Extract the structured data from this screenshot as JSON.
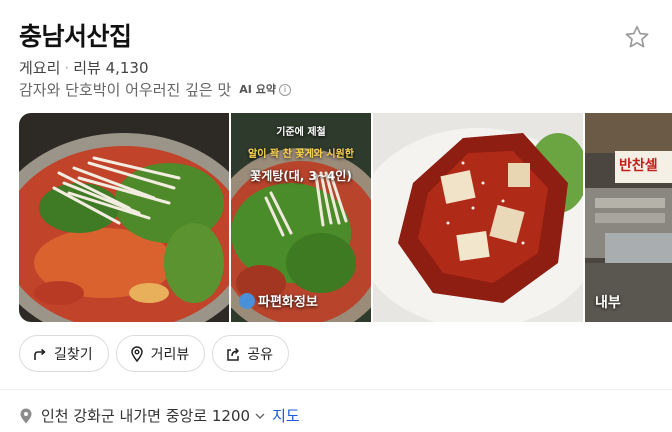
{
  "place": {
    "name": "충남서산집",
    "category": "게요리",
    "review_label": "리뷰",
    "review_count": "4,130",
    "description": "감자와 단호박이 어우러진 깊은 맛",
    "ai_badge": "AI 요약"
  },
  "photos": [
    {
      "label": ""
    },
    {
      "overlay_line1": "기준에 제철",
      "overlay_line2": "알이 꽉 찬 꽃게와 시원한",
      "overlay_line3": "꽃게탕(대, 3~4인)",
      "source": "파편화정보"
    },
    {
      "label": ""
    },
    {
      "label": "내부",
      "sign": "반찬셀"
    }
  ],
  "actions": {
    "directions": "길찾기",
    "street_view": "거리뷰",
    "share": "공유"
  },
  "address": {
    "text": "인천 강화군 내가면 중앙로 1200",
    "map_link": "지도"
  },
  "colors": {
    "link": "#1a5bd6",
    "title": "#111111"
  }
}
